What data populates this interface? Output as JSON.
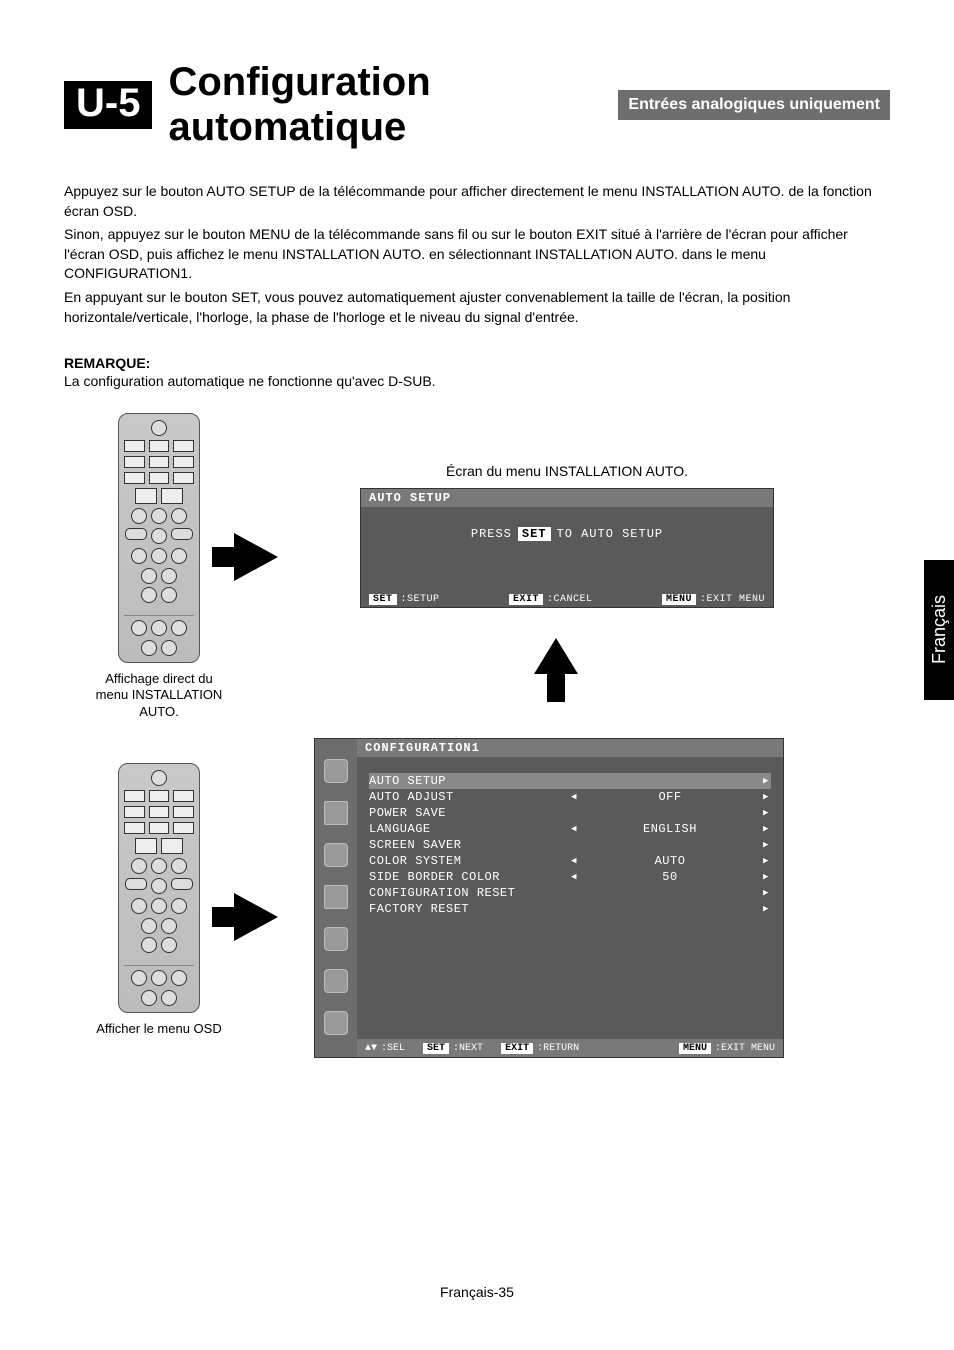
{
  "heading": {
    "id": "U-5",
    "title": "Configuration automatique",
    "banner": "Entrées analogiques uniquement"
  },
  "body": {
    "p1": "Appuyez sur le bouton AUTO SETUP de la télécommande pour afficher directement le menu INSTALLATION AUTO. de la fonction écran OSD.",
    "p2": "Sinon, appuyez sur le bouton MENU de la télécommande sans fil ou sur le bouton EXIT situé à l'arrière de l'écran pour afficher l'écran OSD, puis affichez le menu INSTALLATION AUTO. en sélectionnant INSTALLATION AUTO. dans le menu CONFIGURATION1.",
    "p3": "En appuyant sur le bouton SET, vous pouvez automatiquement ajuster convenablement la taille de l'écran, la position horizontale/verticale, l'horloge, la phase de l'horloge et le niveau du signal d'entrée."
  },
  "note": {
    "label": "REMARQUE:",
    "text": "La configuration automatique ne fonctionne qu'avec D-SUB."
  },
  "captions": {
    "osd_auto": "Écran du menu INSTALLATION AUTO.",
    "remote_top": "Affichage direct du menu INSTALLATION AUTO.",
    "remote_bottom": "Afficher le menu OSD"
  },
  "osd_auto": {
    "title": "AUTO SETUP",
    "prompt_pre": "PRESS",
    "prompt_set": "SET",
    "prompt_post": "TO AUTO SETUP",
    "foot": {
      "set_tag": "SET",
      "set_label": ":SETUP",
      "exit_tag": "EXIT",
      "exit_label": ":CANCEL",
      "menu_tag": "MENU",
      "menu_label": ":EXIT MENU"
    }
  },
  "osd_conf": {
    "title": "CONFIGURATION1",
    "items": [
      {
        "label": "AUTO SETUP",
        "left": "",
        "val": "",
        "right": ">"
      },
      {
        "label": "AUTO ADJUST",
        "left": "<",
        "val": "OFF",
        "right": ">"
      },
      {
        "label": "POWER SAVE",
        "left": "",
        "val": "",
        "right": ">"
      },
      {
        "label": "LANGUAGE",
        "left": "<",
        "val": "ENGLISH",
        "right": ">"
      },
      {
        "label": "SCREEN SAVER",
        "left": "",
        "val": "",
        "right": ">"
      },
      {
        "label": "COLOR SYSTEM",
        "left": "<",
        "val": "AUTO",
        "right": ">"
      },
      {
        "label": "SIDE BORDER COLOR",
        "left": "<",
        "val": "50",
        "right": ">"
      },
      {
        "label": "CONFIGURATION RESET",
        "left": "",
        "val": "",
        "right": ">"
      },
      {
        "label": "FACTORY RESET",
        "left": "",
        "val": "",
        "right": ">"
      }
    ],
    "foot": {
      "sel_tag": "▲▼",
      "sel_label": ":SEL",
      "set_tag": "SET",
      "set_label": ":NEXT",
      "exit_tag": "EXIT",
      "exit_label": ":RETURN",
      "menu_tag": "MENU",
      "menu_label": ":EXIT MENU"
    }
  },
  "side_tab": "Français",
  "page_num": "Français-35"
}
